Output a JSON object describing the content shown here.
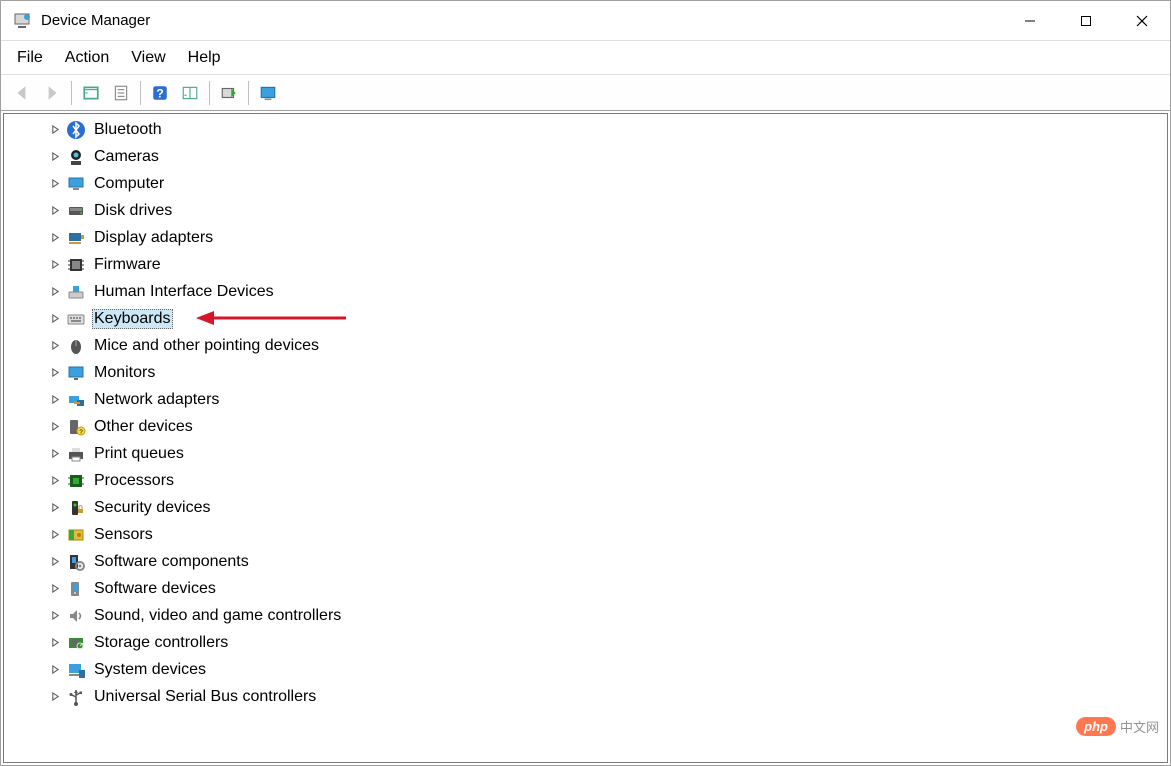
{
  "window": {
    "title": "Device Manager"
  },
  "menu": {
    "items": [
      "File",
      "Action",
      "View",
      "Help"
    ]
  },
  "toolbar": {
    "buttons": [
      {
        "id": "back",
        "name": "back-button",
        "enabled": false
      },
      {
        "id": "forward",
        "name": "forward-button",
        "enabled": false
      },
      {
        "id": "sep"
      },
      {
        "id": "show-hidden",
        "name": "show-hidden-button",
        "enabled": true
      },
      {
        "id": "properties",
        "name": "properties-button",
        "enabled": true
      },
      {
        "id": "sep"
      },
      {
        "id": "help",
        "name": "help-button",
        "enabled": true
      },
      {
        "id": "action-menu",
        "name": "action-menu-button",
        "enabled": true
      },
      {
        "id": "sep"
      },
      {
        "id": "scan",
        "name": "scan-hardware-button",
        "enabled": true
      },
      {
        "id": "sep"
      },
      {
        "id": "monitor",
        "name": "add-legacy-button",
        "enabled": true
      }
    ]
  },
  "tree": {
    "items": [
      {
        "label": "Bluetooth",
        "icon": "bluetooth-icon",
        "selected": false
      },
      {
        "label": "Cameras",
        "icon": "camera-icon",
        "selected": false
      },
      {
        "label": "Computer",
        "icon": "computer-icon",
        "selected": false
      },
      {
        "label": "Disk drives",
        "icon": "disk-icon",
        "selected": false
      },
      {
        "label": "Display adapters",
        "icon": "display-adapter-icon",
        "selected": false
      },
      {
        "label": "Firmware",
        "icon": "firmware-icon",
        "selected": false
      },
      {
        "label": "Human Interface Devices",
        "icon": "hid-icon",
        "selected": false
      },
      {
        "label": "Keyboards",
        "icon": "keyboard-icon",
        "selected": true
      },
      {
        "label": "Mice and other pointing devices",
        "icon": "mouse-icon",
        "selected": false
      },
      {
        "label": "Monitors",
        "icon": "monitor-icon",
        "selected": false
      },
      {
        "label": "Network adapters",
        "icon": "network-icon",
        "selected": false
      },
      {
        "label": "Other devices",
        "icon": "other-icon",
        "selected": false
      },
      {
        "label": "Print queues",
        "icon": "printer-icon",
        "selected": false
      },
      {
        "label": "Processors",
        "icon": "processor-icon",
        "selected": false
      },
      {
        "label": "Security devices",
        "icon": "security-icon",
        "selected": false
      },
      {
        "label": "Sensors",
        "icon": "sensor-icon",
        "selected": false
      },
      {
        "label": "Software components",
        "icon": "software-component-icon",
        "selected": false
      },
      {
        "label": "Software devices",
        "icon": "software-device-icon",
        "selected": false
      },
      {
        "label": "Sound, video and game controllers",
        "icon": "sound-icon",
        "selected": false
      },
      {
        "label": "Storage controllers",
        "icon": "storage-icon",
        "selected": false
      },
      {
        "label": "System devices",
        "icon": "system-icon",
        "selected": false
      },
      {
        "label": "Universal Serial Bus controllers",
        "icon": "usb-icon",
        "selected": false
      }
    ]
  },
  "watermark": {
    "pill": "php",
    "text": "中文网"
  }
}
